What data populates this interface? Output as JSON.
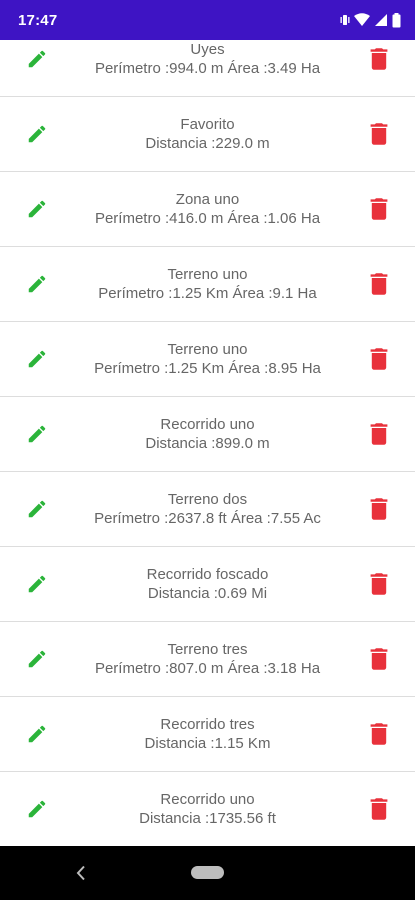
{
  "status_bar": {
    "time": "17:47",
    "icons": [
      "vibrate-icon",
      "wifi-icon",
      "signal-icon",
      "battery-icon"
    ],
    "background": "#3e14c4"
  },
  "colors": {
    "edit": "#2bb43a",
    "delete": "#e8313b",
    "text": "#666666",
    "divider": "#dddddd"
  },
  "items": [
    {
      "title": "Uyes",
      "detail": "Perímetro :994.0 m Área :3.49 Ha"
    },
    {
      "title": "Favorito",
      "detail": "Distancia :229.0 m"
    },
    {
      "title": "Zona uno",
      "detail": "Perímetro :416.0 m Área :1.06 Ha"
    },
    {
      "title": "Terreno uno",
      "detail": "Perímetro :1.25 Km Área :9.1 Ha"
    },
    {
      "title": "Terreno uno",
      "detail": "Perímetro :1.25 Km Área :8.95 Ha"
    },
    {
      "title": "Recorrido uno",
      "detail": "Distancia :899.0 m"
    },
    {
      "title": "Terreno dos",
      "detail": "Perímetro :2637.8 ft Área :7.55 Ac"
    },
    {
      "title": "Recorrido foscado",
      "detail": "Distancia :0.69 Mi"
    },
    {
      "title": "Terreno tres",
      "detail": "Perímetro :807.0 m Área :3.18 Ha"
    },
    {
      "title": "Recorrido tres",
      "detail": "Distancia :1.15 Km"
    },
    {
      "title": "Recorrido uno",
      "detail": "Distancia :1735.56 ft"
    }
  ],
  "navigation_bar": {
    "buttons": [
      "back-icon",
      "home-pill"
    ]
  }
}
